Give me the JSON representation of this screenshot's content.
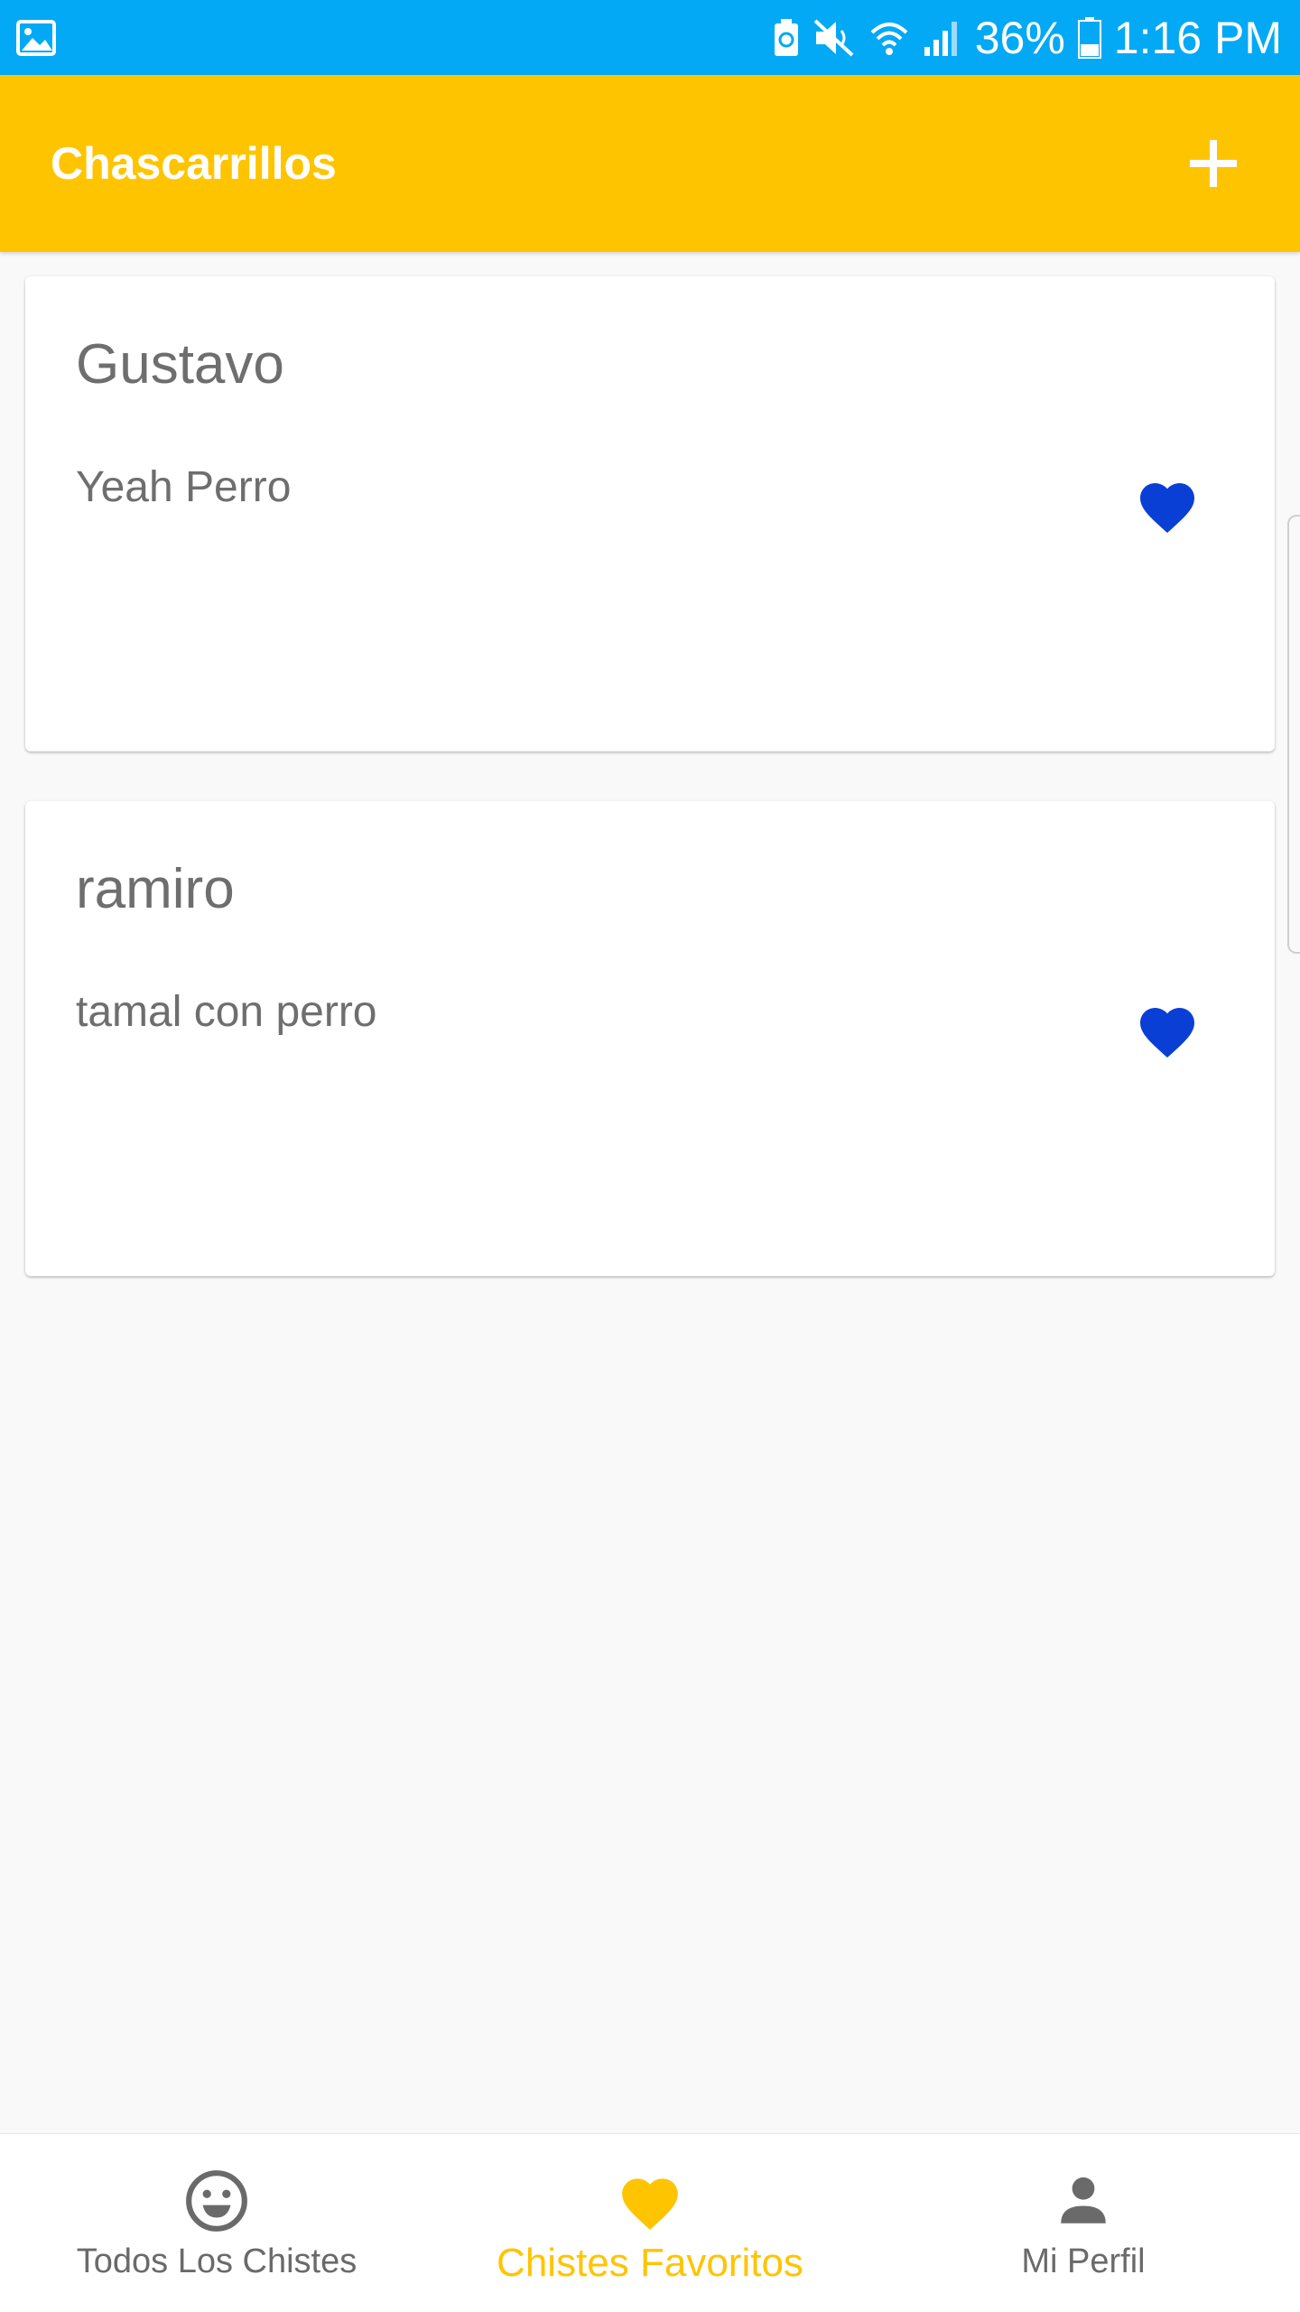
{
  "status_bar": {
    "battery": "36%",
    "time": "1:16 PM",
    "icons": [
      "gallery-icon",
      "battery-saver-icon",
      "mute-icon",
      "wifi-icon",
      "signal-icon",
      "battery-icon"
    ]
  },
  "app_bar": {
    "title": "Chascarrillos",
    "add_icon": "plus-icon"
  },
  "jokes": [
    {
      "author": "Gustavo",
      "text": "Yeah Perro",
      "favorite": true
    },
    {
      "author": "ramiro",
      "text": "tamal con perro",
      "favorite": true
    }
  ],
  "bottom_nav": {
    "items": [
      {
        "label": "Todos Los Chistes",
        "icon": "smiley-icon",
        "active": false
      },
      {
        "label": "Chistes Favoritos",
        "icon": "heart-icon",
        "active": true
      },
      {
        "label": "Mi Perfil",
        "icon": "person-icon",
        "active": false
      }
    ]
  },
  "colors": {
    "status_bar": "#03a9f4",
    "app_bar": "#ffc400",
    "favorite_heart": "#0a3fd6",
    "active_nav": "#ffc400",
    "inactive_nav": "#6a6a6a"
  }
}
